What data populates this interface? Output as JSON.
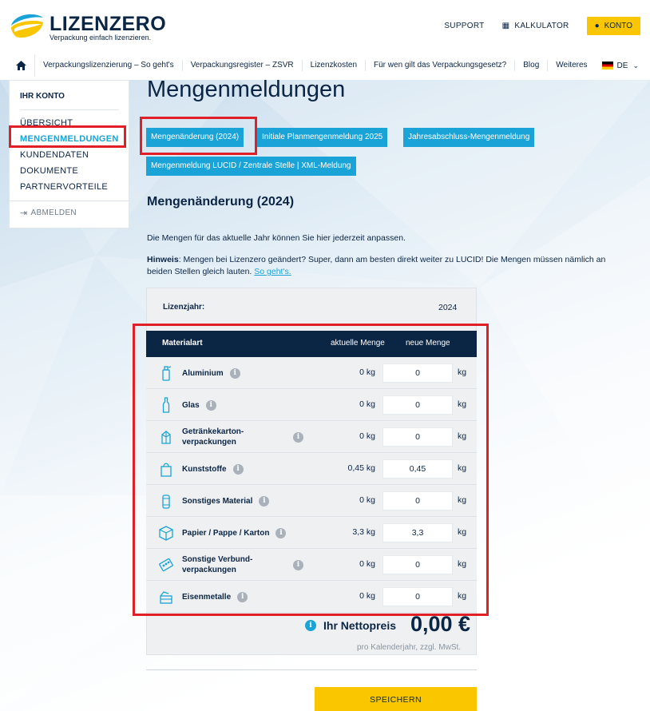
{
  "brand": {
    "name": "LIZENZERO",
    "claim": "Verpackung einfach lizenzieren."
  },
  "topbar": {
    "support": "SUPPORT",
    "calculator": "KALKULATOR",
    "account": "KONTO"
  },
  "nav": {
    "items": [
      "Verpackungslizenzierung – So geht's",
      "Verpackungsregister – ZSVR",
      "Lizenzkosten",
      "Für wen gilt das Verpackungsgesetz?",
      "Blog",
      "Weiteres"
    ],
    "language": "DE"
  },
  "sidebar": {
    "title": "IHR KONTO",
    "items": [
      "ÜBERSICHT",
      "MENGENMELDUNGEN",
      "KUNDENDATEN",
      "DOKUMENTE",
      "PARTNERVORTEILE"
    ],
    "active_index": 1,
    "logout": "ABMELDEN"
  },
  "page": {
    "title": "Mengenmeldungen",
    "tabs": [
      "Mengenänderung (2024)",
      "Initiale Planmengenmeldung 2025",
      "Jahresabschluss-Mengenmeldung",
      "Mengenmeldung LUCID / Zentrale Stelle | XML-Meldung"
    ],
    "section_title": "Mengenänderung (2024)",
    "intro": "Die Mengen für das aktuelle Jahr können Sie hier jederzeit anpassen.",
    "hint_label": "Hinweis",
    "hint_text": ": Mengen bei Lizenzero geändert? Super, dann am besten direkt weiter zu LUCID! Die Mengen müssen nämlich an beiden Stellen gleich lauten.",
    "hint_link": "So geht's."
  },
  "table": {
    "year_label": "Lizenzjahr:",
    "year_value": "2024",
    "col_material": "Materialart",
    "col_current": "aktuelle Menge",
    "col_new": "neue Menge",
    "unit": "kg",
    "rows": [
      {
        "icon": "spray-can-icon",
        "name": "Aluminium",
        "current": "0 kg",
        "new": "0"
      },
      {
        "icon": "bottle-icon",
        "name": "Glas",
        "current": "0 kg",
        "new": "0"
      },
      {
        "icon": "beverage-carton-icon",
        "name": "Getränkekarton-verpackungen",
        "current": "0 kg",
        "new": "0"
      },
      {
        "icon": "plastic-bag-icon",
        "name": "Kunststoffe",
        "current": "0,45 kg",
        "new": "0,45"
      },
      {
        "icon": "cup-icon",
        "name": "Sonstiges Material",
        "current": "0 kg",
        "new": "0"
      },
      {
        "icon": "cardboard-box-icon",
        "name": "Papier / Pappe / Karton",
        "current": "3,3 kg",
        "new": "3,3"
      },
      {
        "icon": "blister-pack-icon",
        "name": "Sonstige Verbund-verpackungen",
        "current": "0 kg",
        "new": "0"
      },
      {
        "icon": "tin-can-icon",
        "name": "Eisenmetalle",
        "current": "0 kg",
        "new": "0"
      }
    ]
  },
  "price": {
    "label": "Ihr Nettopreis",
    "value": "0,00 €",
    "note": "pro Kalenderjahr, zzgl. MwSt."
  },
  "save_label": "SPEICHERN",
  "colors": {
    "navy": "#0b2545",
    "accent_blue": "#1aa3d6",
    "yellow": "#f9c600",
    "highlight_red": "#e02026"
  }
}
